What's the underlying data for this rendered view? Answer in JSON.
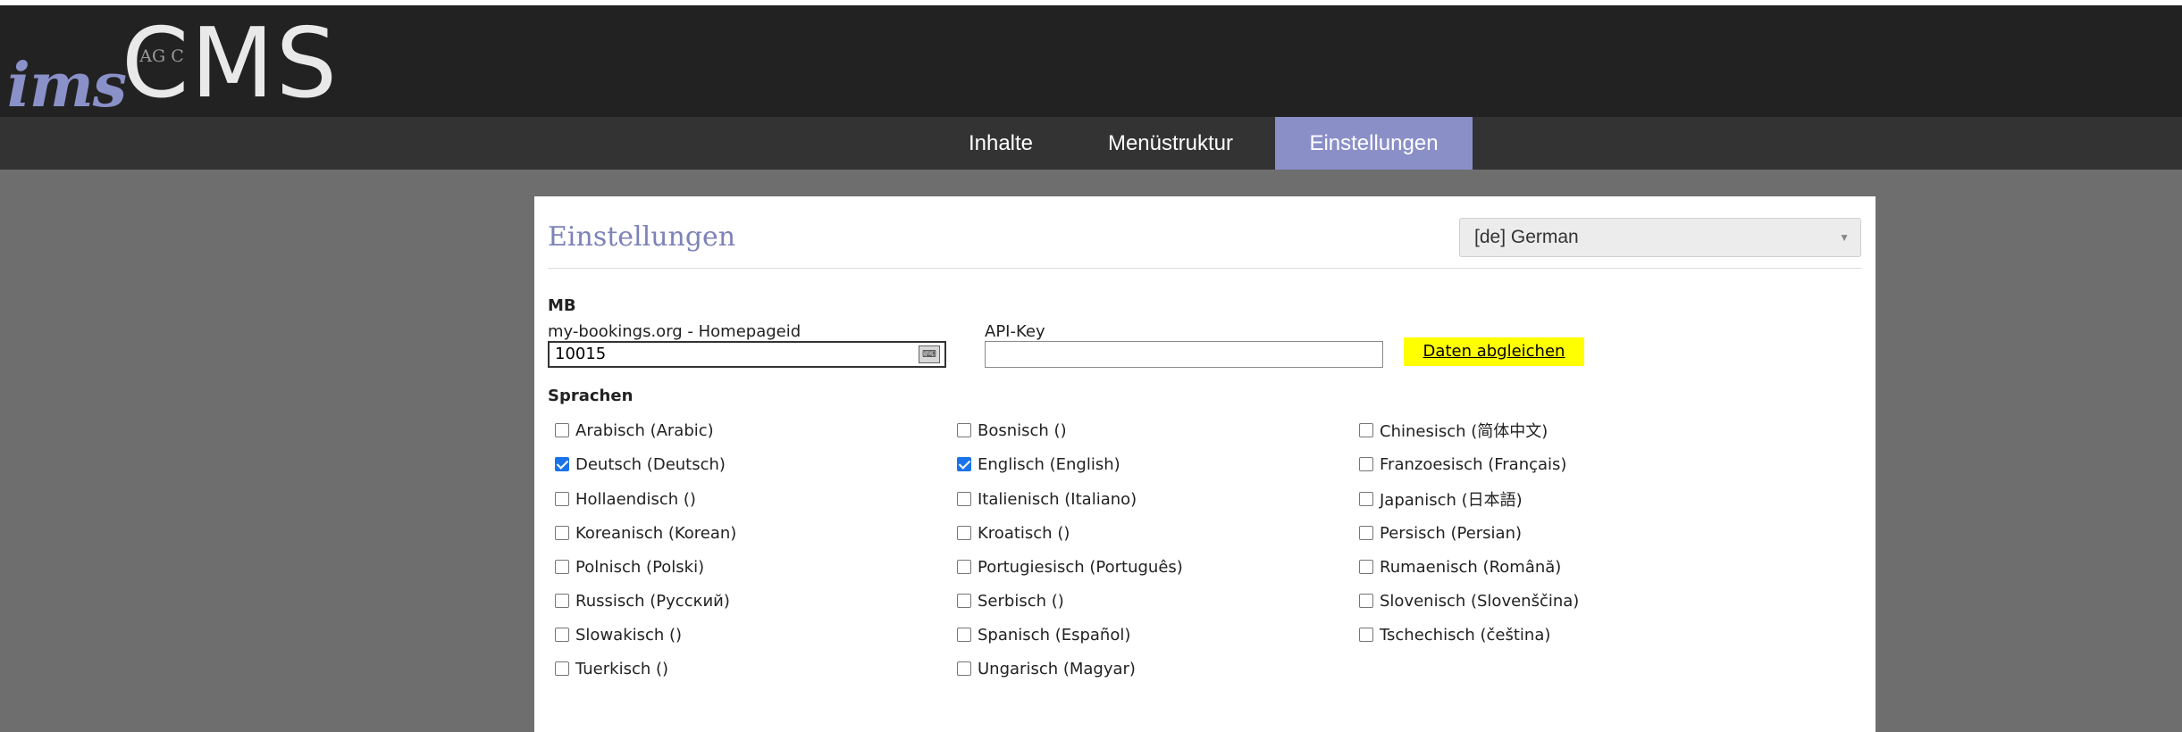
{
  "header": {
    "logo": {
      "ims": "ims",
      "agc": "AG C",
      "cms": "CMS"
    }
  },
  "nav": {
    "items": [
      {
        "label": "Inhalte"
      },
      {
        "label": "Menüstruktur"
      },
      {
        "label": "Einstellungen",
        "active": true
      }
    ]
  },
  "panel": {
    "title": "Einstellungen",
    "language_select": {
      "value": "[de] German"
    },
    "mb": {
      "heading": "MB",
      "homepageid_label": "my-bookings.org - Homepageid",
      "homepageid_value": "10015",
      "apikey_label": "API-Key",
      "apikey_value": "",
      "sync_link": "Daten abgleichen"
    },
    "sprachen": {
      "heading": "Sprachen",
      "languages": [
        {
          "label": "Arabisch (Arabic)",
          "checked": false
        },
        {
          "label": "Bosnisch ()",
          "checked": false
        },
        {
          "label": "Chinesisch (简体中文)",
          "checked": false
        },
        {
          "label": "Deutsch (Deutsch)",
          "checked": true
        },
        {
          "label": "Englisch (English)",
          "checked": true
        },
        {
          "label": "Franzoesisch (Français)",
          "checked": false
        },
        {
          "label": "Hollaendisch ()",
          "checked": false
        },
        {
          "label": "Italienisch (Italiano)",
          "checked": false
        },
        {
          "label": "Japanisch (日本語)",
          "checked": false
        },
        {
          "label": "Koreanisch (Korean)",
          "checked": false
        },
        {
          "label": "Kroatisch ()",
          "checked": false
        },
        {
          "label": "Persisch (Persian)",
          "checked": false
        },
        {
          "label": "Polnisch (Polski)",
          "checked": false
        },
        {
          "label": "Portugiesisch (Português)",
          "checked": false
        },
        {
          "label": "Rumaenisch (Română)",
          "checked": false
        },
        {
          "label": "Russisch (Русский)",
          "checked": false
        },
        {
          "label": "Serbisch ()",
          "checked": false
        },
        {
          "label": "Slovenisch (Slovenščina)",
          "checked": false
        },
        {
          "label": "Slowakisch ()",
          "checked": false
        },
        {
          "label": "Spanisch (Español)",
          "checked": false
        },
        {
          "label": "Tschechisch (čeština)",
          "checked": false
        },
        {
          "label": "Tuerkisch ()",
          "checked": false
        },
        {
          "label": "Ungarisch (Magyar)",
          "checked": false
        }
      ]
    }
  },
  "colors": {
    "accent": "#8a8fc7",
    "header_bg": "#222222",
    "nav_bg": "#333333",
    "page_bg": "#6e6e6e",
    "highlight": "#ffff00",
    "checkbox_checked": "#1a73e8"
  }
}
